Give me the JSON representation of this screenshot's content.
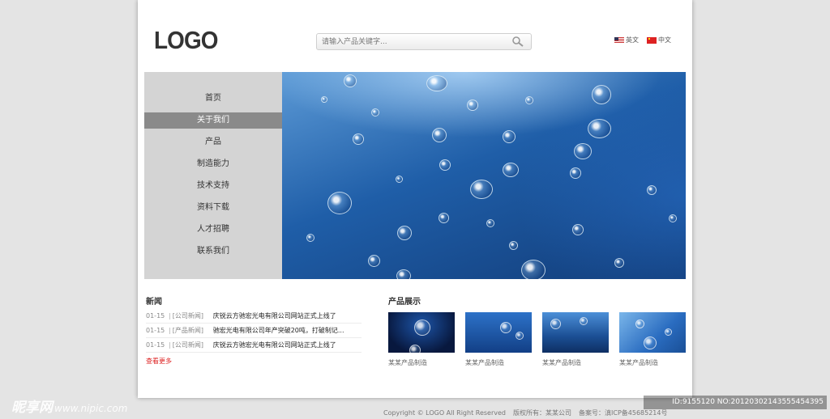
{
  "header": {
    "logo": "LOGO",
    "search": {
      "placeholder": "请输入产品关键字..."
    },
    "lang": {
      "en_label": "英文",
      "cn_label": "中文"
    }
  },
  "nav": {
    "items": [
      {
        "label": "首页"
      },
      {
        "label": "关于我们",
        "active": true
      },
      {
        "label": "产品"
      },
      {
        "label": "制造能力"
      },
      {
        "label": "技术支持"
      },
      {
        "label": "资料下载"
      },
      {
        "label": "人才招聘"
      },
      {
        "label": "联系我们"
      }
    ]
  },
  "news": {
    "title": "新闻",
    "items": [
      {
        "date": "01-15",
        "sep": "|",
        "category": "[公司新闻]",
        "text": "庆锐云方驰宏光电有限公司网站正式上线了"
      },
      {
        "date": "01-15",
        "sep": "|",
        "category": "[产品新闻]",
        "text": "驰宏光电有限公司年产突破20吨，打破制记..."
      },
      {
        "date": "01-15",
        "sep": "|",
        "category": "[公司新闻]",
        "text": "庆锐云方驰宏光电有限公司网站正式上线了"
      }
    ],
    "more": "查看更多"
  },
  "products": {
    "title": "产品展示",
    "items": [
      {
        "caption": "某某产品制造"
      },
      {
        "caption": "某某产品制造"
      },
      {
        "caption": "某某产品制造"
      },
      {
        "caption": "某某产品制造"
      }
    ]
  },
  "footer": {
    "copyright": "Copyright © LOGO All Right Reserved",
    "owner": "版权所有：某某公司",
    "icp": "备案号：滇ICP备45685214号"
  },
  "watermark": {
    "left_brand": "昵享网",
    "left_url": "www.nipic.com",
    "right_id": "ID:9155120 NO:20120302143555454395"
  },
  "colors": {
    "nav_background": "#d4d4d4",
    "nav_active": "#8a8a8a",
    "banner_blue": "#1f5ea8",
    "more_link": "#dd2222"
  },
  "icons": {
    "search": "magnifier-icon",
    "lang_en": "us-flag-icon",
    "lang_cn": "china-flag-icon"
  }
}
